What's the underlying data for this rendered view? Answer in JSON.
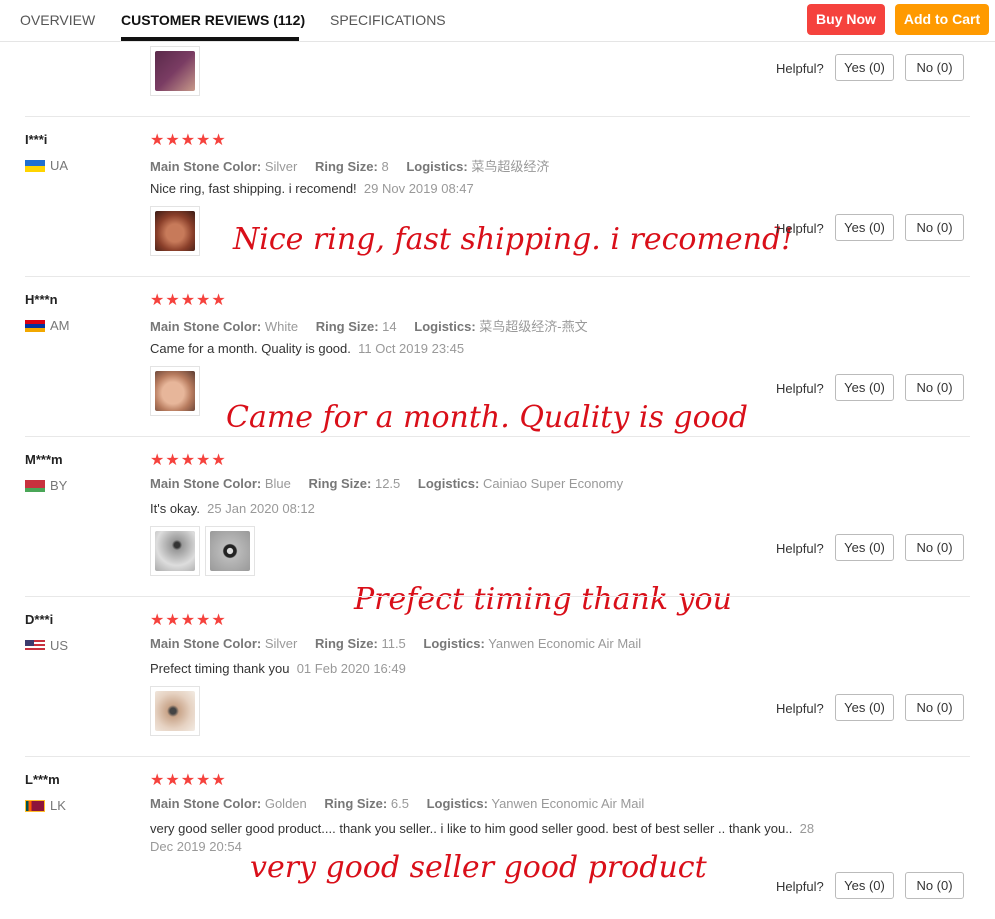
{
  "tabs": [
    {
      "label": "OVERVIEW"
    },
    {
      "label": "CUSTOMER REVIEWS (112)"
    },
    {
      "label": "SPECIFICATIONS"
    }
  ],
  "buttons": {
    "buy_now": "Buy Now",
    "add_to_cart": "Add to Cart"
  },
  "labels": {
    "helpful": "Helpful?",
    "yes": "Yes (0)",
    "no": "No (0)",
    "main_stone_color": "Main Stone Color:",
    "ring_size": "Ring Size:",
    "logistics": "Logistics:",
    "stars": "★★★★★"
  },
  "colors": {
    "accent_red": "#f5423d",
    "accent_orange": "#ff9a00",
    "overlay_red": "#d90f19"
  },
  "reviews": [
    {
      "user": "I***i",
      "country": "UA",
      "stone_color": "Silver",
      "ring_size": "8",
      "logistics": "菜鸟超级经济",
      "text": "Nice ring, fast shipping. i recomend!",
      "date": "29 Nov 2019 08:47",
      "overlay": "Nice ring, fast shipping. i recomend!"
    },
    {
      "user": "H***n",
      "country": "AM",
      "stone_color": "White",
      "ring_size": "14",
      "logistics": "菜鸟超级经济-燕文",
      "text": "Came for a month. Quality is good.",
      "date": "11 Oct 2019 23:45",
      "overlay": "Came for a month. Quality is good"
    },
    {
      "user": "M***m",
      "country": "BY",
      "stone_color": "Blue",
      "ring_size": "12.5",
      "logistics": "Cainiao Super Economy",
      "text": "It's okay.",
      "date": "25 Jan 2020 08:12",
      "overlay": "Prefect timing thank you"
    },
    {
      "user": "D***i",
      "country": "US",
      "stone_color": "Silver",
      "ring_size": "11.5",
      "logistics": "Yanwen Economic Air Mail",
      "text": "Prefect timing thank you",
      "date": "01 Feb 2020 16:49"
    },
    {
      "user": "L***m",
      "country": "LK",
      "stone_color": "Golden",
      "ring_size": "6.5",
      "logistics": "Yanwen Economic Air Mail",
      "text": "very good seller good product.... thank you seller.. i like to him good seller good. best of best seller .. thank you..",
      "date_part1": "28",
      "date_part2": "Dec 2019 20:54",
      "overlay": "very good seller good product"
    }
  ]
}
